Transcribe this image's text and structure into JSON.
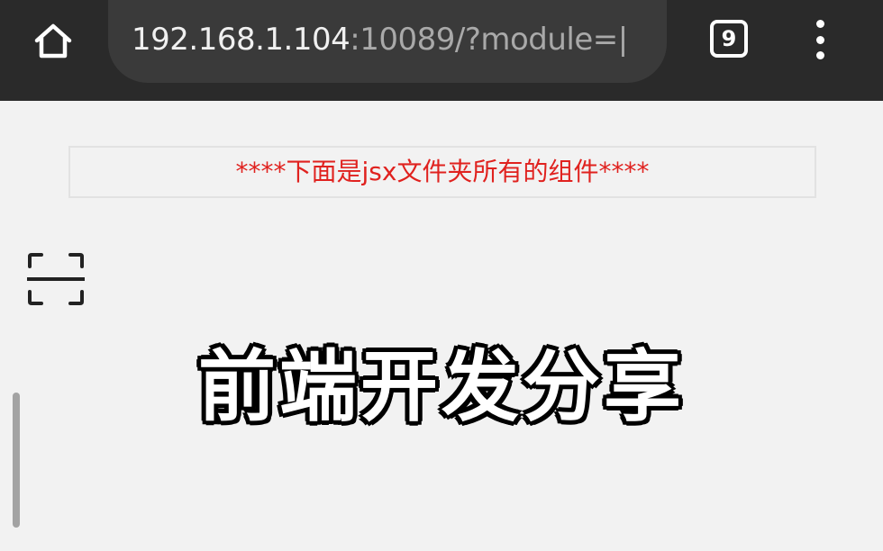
{
  "browser": {
    "url_host": "192.168.1.104",
    "url_rest": ":10089/?module=|",
    "tab_count": "9",
    "icons": {
      "home": "home-icon",
      "tabs": "tab-counter-icon",
      "menu": "more-vertical-icon"
    }
  },
  "page": {
    "banner_text": "****下面是jsx文件夹所有的组件****",
    "scan_icon": "scan-icon"
  },
  "overlay": {
    "title": "前端开发分享"
  },
  "colors": {
    "toolbar_bg": "#2a2a2a",
    "url_pill_bg": "#3a3a3a",
    "page_bg": "#f2f2f2",
    "banner_text": "#e0221f",
    "banner_border": "#e2e2e2"
  }
}
